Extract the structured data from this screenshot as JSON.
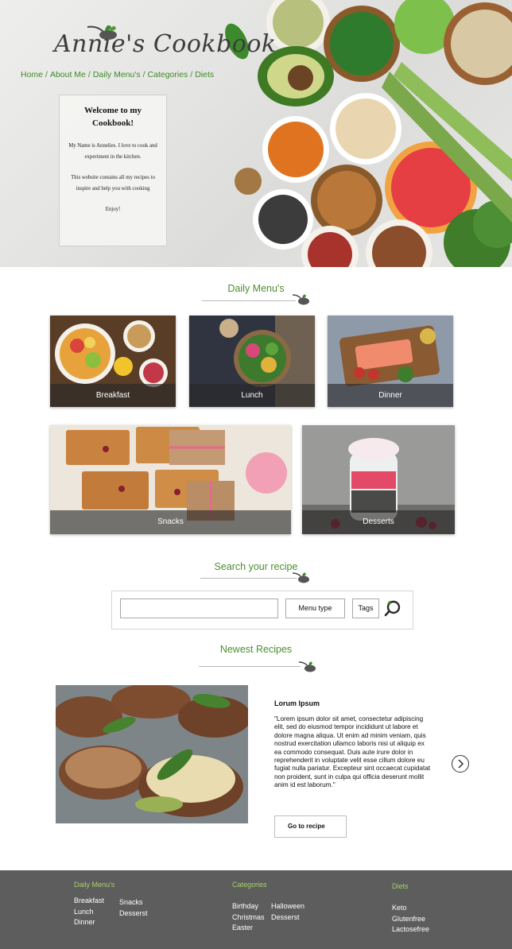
{
  "brand": {
    "name": "Annie's Cookbook"
  },
  "breadcrumb": [
    "Home",
    "About Me",
    "Daily Menu's",
    "Categories",
    "Diets"
  ],
  "welcome": {
    "title": "Welcome to my Cookbook!",
    "p1": "My Name is Annelies. I love to cook and experiment in the kitchen.",
    "p2": "This website contains all my recipes to inspire and help you with cooking",
    "p3": "Enjoy!"
  },
  "daily_menus": {
    "title": "Daily Menu's",
    "cards": [
      "Breakfast",
      "Lunch",
      "Dinner",
      "Snacks",
      "Desserts"
    ]
  },
  "search": {
    "title": "Search your recipe",
    "input_value": "",
    "menu_type_label": "Menu type",
    "tags_label": "Tags"
  },
  "newest": {
    "title": "Newest Recipes",
    "recipe_title": "Lorum Ipsum",
    "recipe_text": "\"Lorem ipsum dolor sit amet, consectetur adipiscing elit, sed do eiusmod tempor incididunt ut labore et dolore magna aliqua. Ut enim ad minim veniam, quis nostrud exercitation ullamco laboris nisi ut aliquip ex ea commodo consequat. Duis aute irure dolor in reprehenderit in voluptate velit esse cillum dolore eu fugiat nulla pariatur. Excepteur sint occaecat cupidatat non proident, sunt in culpa qui officia deserunt mollit anim id est laborum.\"",
    "go_label": "Go to recipe"
  },
  "footer": {
    "daily_head": "Daily Menu's",
    "daily_col1": [
      "Breakfast",
      "Lunch",
      "Dinner"
    ],
    "daily_col2": [
      "Snacks",
      "Desserst"
    ],
    "cat_head": "Categories",
    "cat_col1": [
      "Birthday",
      "Christmas",
      "Easter"
    ],
    "cat_col2": [
      "Halloween",
      "Desserst"
    ],
    "diet_head": "Diets",
    "diet_col": [
      "Keto",
      "Glutenfree",
      "Lactosefree"
    ]
  },
  "colors": {
    "accent_green": "#4b8f2e",
    "footer_bg": "#5d5d5d",
    "footer_head": "#a8d16a"
  },
  "icons": [
    "spoon-herb-icon",
    "search-icon",
    "chevron-right-icon"
  ]
}
